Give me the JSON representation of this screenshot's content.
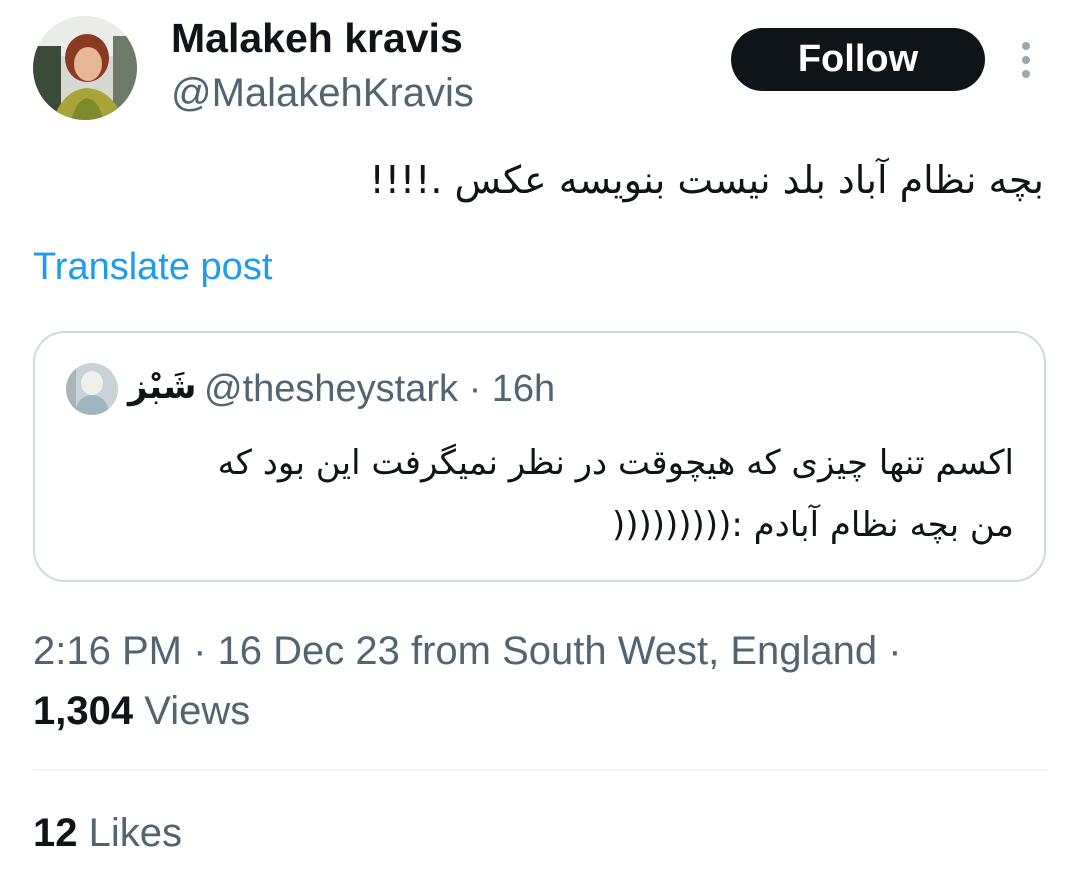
{
  "author": {
    "display_name": "Malakeh kravis",
    "handle": "@MalakehKravis",
    "avatar": "profile-photo"
  },
  "follow_button": {
    "label": "Follow"
  },
  "more_menu": {
    "icon": "more-vertical-icon"
  },
  "post": {
    "text": "بچه نظام آباد بلد نیست بنویسه عکس .!!!!",
    "translate_label": "Translate post"
  },
  "quoted_post": {
    "author_name": "شَبْز",
    "meta": "@thesheystark · 16h",
    "text_lines": [
      "اکسم تنها چیزی که هیچوقت در نظر نمیگرفت این بود که",
      "من بچه نظام آبادم :((((((((("
    ]
  },
  "meta": {
    "timestamp_location": "2:16 PM · 16 Dec 23 from South West, England ·",
    "views_count": "1,304",
    "views_label": "Views"
  },
  "stats": {
    "likes_count": "12",
    "likes_label": "Likes"
  },
  "colors": {
    "text_primary": "#0f1419",
    "text_secondary": "#536471",
    "link": "#1d9bf0",
    "button_bg": "#0f1419",
    "border": "#cfd9de"
  }
}
